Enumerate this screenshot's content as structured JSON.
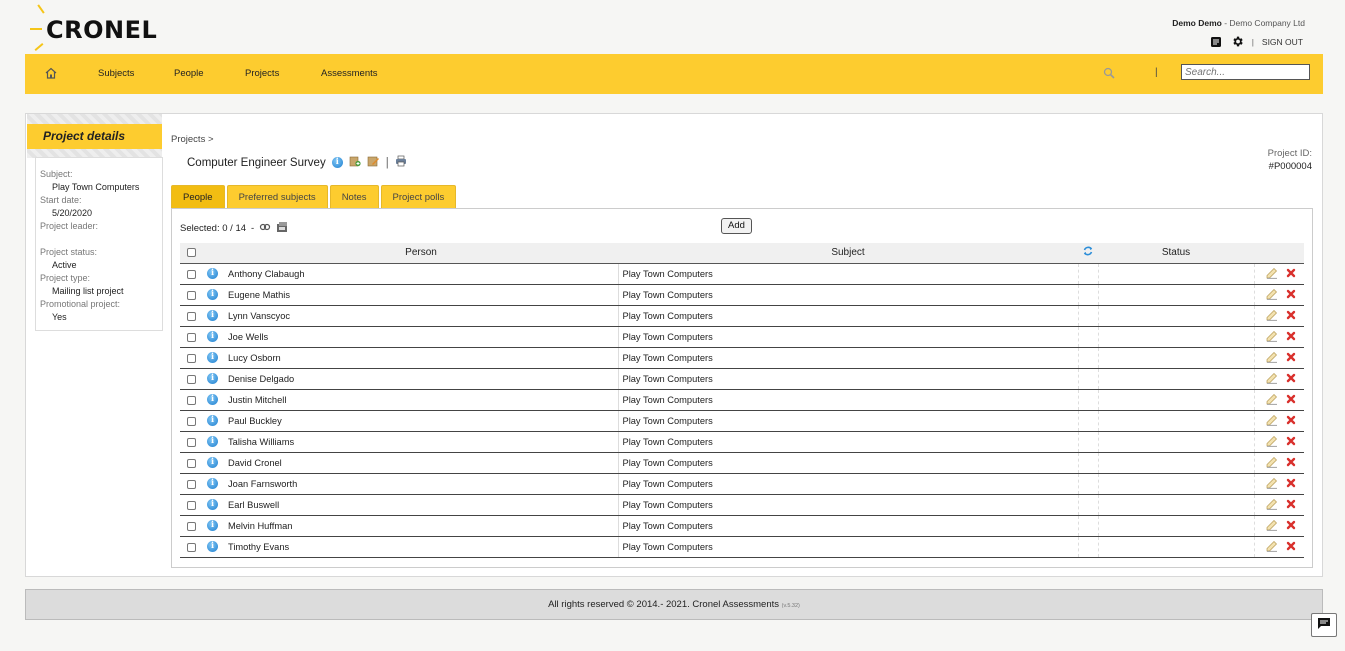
{
  "app": {
    "logo_text": "CRONEL",
    "user_name": "Demo Demo",
    "user_company": " - Demo Company Ltd",
    "sign_out": "SIGN OUT"
  },
  "nav": {
    "items": [
      "Subjects",
      "People",
      "Projects",
      "Assessments"
    ],
    "search_placeholder": "Search..."
  },
  "sidebar": {
    "title": "Project details",
    "fields": [
      {
        "label": "Subject:",
        "value": "Play Town Computers"
      },
      {
        "label": "Start date:",
        "value": "5/20/2020"
      },
      {
        "label": "Project leader:",
        "value": ""
      },
      {
        "label": "Project status:",
        "value": "Active"
      },
      {
        "label": "Project type:",
        "value": "Mailing list project"
      },
      {
        "label": "Promotional project:",
        "value": "Yes"
      }
    ]
  },
  "project": {
    "breadcrumb": "Projects >",
    "title": "Computer Engineer Survey",
    "id_label": "Project ID:",
    "id_value": "#P000004"
  },
  "tabs": [
    "People",
    "Preferred subjects",
    "Notes",
    "Project polls"
  ],
  "active_tab": "People",
  "toolbar": {
    "selected_text": "Selected: 0 / 14",
    "dash": "-",
    "add_label": "Add"
  },
  "table": {
    "headers": {
      "person": "Person",
      "subject": "Subject",
      "status": "Status"
    },
    "rows": [
      {
        "person": "Anthony Clabaugh",
        "subject": "Play Town Computers"
      },
      {
        "person": "Eugene Mathis",
        "subject": "Play Town Computers"
      },
      {
        "person": "Lynn Vanscyoc",
        "subject": "Play Town Computers"
      },
      {
        "person": "Joe Wells",
        "subject": "Play Town Computers"
      },
      {
        "person": "Lucy Osborn",
        "subject": "Play Town Computers"
      },
      {
        "person": "Denise Delgado",
        "subject": "Play Town Computers"
      },
      {
        "person": "Justin Mitchell",
        "subject": "Play Town Computers"
      },
      {
        "person": "Paul Buckley",
        "subject": "Play Town Computers"
      },
      {
        "person": "Talisha Williams",
        "subject": "Play Town Computers"
      },
      {
        "person": "David Cronel",
        "subject": "Play Town Computers"
      },
      {
        "person": "Joan Farnsworth",
        "subject": "Play Town Computers"
      },
      {
        "person": "Earl Buswell",
        "subject": "Play Town Computers"
      },
      {
        "person": "Melvin Huffman",
        "subject": "Play Town Computers"
      },
      {
        "person": "Timothy Evans",
        "subject": "Play Town Computers"
      }
    ]
  },
  "footer": {
    "text": "All rights reserved © 2014.- 2021. Cronel Assessments",
    "version": "(v.5.32)"
  },
  "colors": {
    "accent": "#fdcc2f",
    "active_tab": "#f2bd12",
    "delete": "#d9302c",
    "info": "#1f7fcf"
  }
}
